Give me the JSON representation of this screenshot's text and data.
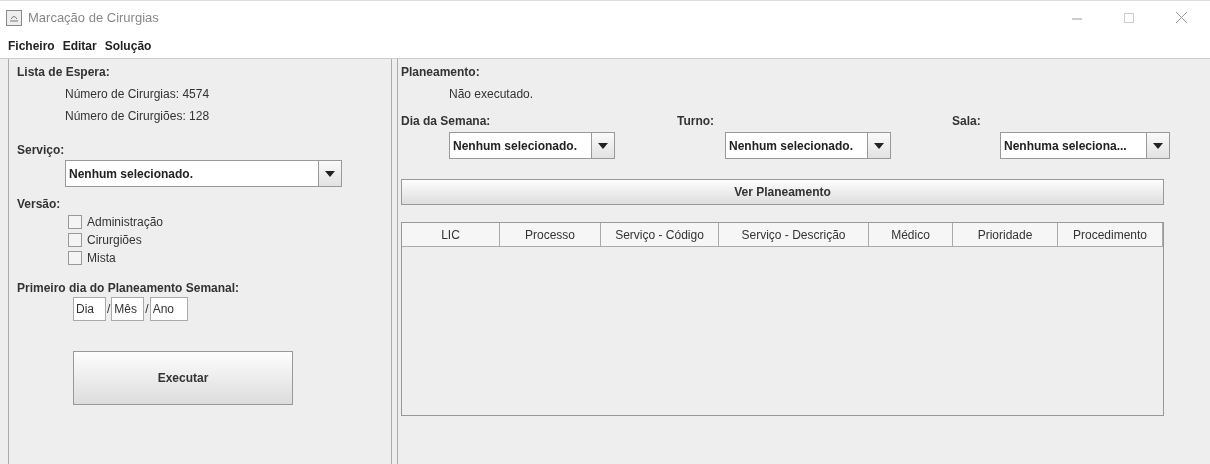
{
  "window": {
    "title": "Marcação de Cirurgias"
  },
  "menu": [
    "Ficheiro",
    "Editar",
    "Solução"
  ],
  "waiting_list": {
    "heading": "Lista de Espera:",
    "lines": [
      "Número de Cirurgias: 4574",
      "Número de Cirurgiões: 128"
    ]
  },
  "service": {
    "label": "Serviço:",
    "value": "Nenhum selecionado."
  },
  "version": {
    "label": "Versão:",
    "options": [
      {
        "label": "Administração",
        "checked": false
      },
      {
        "label": "Cirurgiões",
        "checked": false
      },
      {
        "label": "Mista",
        "checked": false
      }
    ]
  },
  "first_day": {
    "label": "Primeiro dia do Planeamento Semanal:",
    "fields": [
      {
        "placeholder": "Dia"
      },
      {
        "placeholder": "Mês"
      },
      {
        "placeholder": "Ano"
      }
    ],
    "separators": [
      "/",
      "/"
    ]
  },
  "run_button": "Executar",
  "planning": {
    "heading": "Planeamento:",
    "status": "Não executado."
  },
  "filters": [
    {
      "label": "Dia da Semana:",
      "value": "Nenhum selecionado."
    },
    {
      "label": "Turno:",
      "value": "Nenhum selecionado."
    },
    {
      "label": "Sala:",
      "value": "Nenhuma seleciona..."
    }
  ],
  "view_button": "Ver Planeamento",
  "table": {
    "columns": [
      "LIC",
      "Processo",
      "Serviço - Código",
      "Serviço - Descrição",
      "Médico",
      "Prioridade",
      "Procedimento"
    ]
  }
}
